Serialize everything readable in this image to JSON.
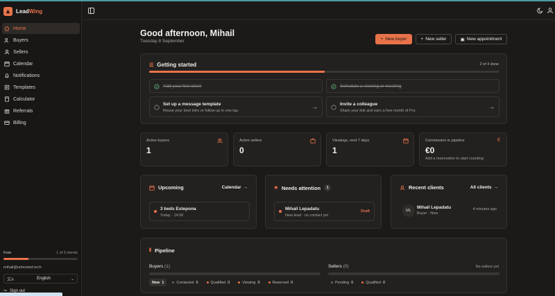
{
  "app": {
    "brand_part1": "Lead",
    "brand_part2": "Wing"
  },
  "colors": {
    "accent": "#e8734a",
    "background": "#1c1a19",
    "card": "#23211f"
  },
  "sidebar": {
    "items": [
      {
        "label": "Home",
        "icon": "home-icon",
        "active": true
      },
      {
        "label": "Buyers",
        "icon": "users-icon"
      },
      {
        "label": "Sellers",
        "icon": "user-icon"
      },
      {
        "label": "Calendar",
        "icon": "calendar-icon"
      },
      {
        "label": "Notifications",
        "icon": "bell-icon"
      },
      {
        "label": "Templates",
        "icon": "template-icon"
      },
      {
        "label": "Calculator",
        "icon": "calculator-icon"
      },
      {
        "label": "Referrals",
        "icon": "referral-icon"
      },
      {
        "label": "Billing",
        "icon": "card-icon"
      }
    ],
    "plan": {
      "name": "Free",
      "usage": "1 of 3 clients",
      "fraction": 0.333
    },
    "email": "mihail@unhosted.tech",
    "language": "English",
    "sign_out": "Sign out"
  },
  "main": {
    "greeting": "Good afternoon, Mihail",
    "date": "Tuesday 8 September",
    "actions": {
      "new_buyer": "New buyer",
      "new_seller": "New seller",
      "new_appointment": "New appointment"
    },
    "getting_started": {
      "title": "Getting started",
      "count": "2 of 4 done",
      "progress": 0.5,
      "tasks": [
        {
          "title": "Add your first client",
          "done": true
        },
        {
          "title": "Schedule a viewing or meeting",
          "done": true
        },
        {
          "title": "Set up a message template",
          "subtitle": "Reuse your best intro or follow-up in one tap."
        },
        {
          "title": "Invite a colleague",
          "subtitle": "Share your link and earn a free month of Pro."
        }
      ]
    },
    "stats": [
      {
        "label": "Active buyers",
        "value": "1",
        "icon": "users-icon"
      },
      {
        "label": "Active sellers",
        "value": "0",
        "icon": "briefcase-icon"
      },
      {
        "label": "Viewings, next 7 days",
        "value": "1",
        "icon": "calendar-icon"
      },
      {
        "label": "Commission in pipeline",
        "value": "€0",
        "icon": "euro-icon",
        "note": "Add a reservation to start counting"
      }
    ],
    "upcoming": {
      "title": "Upcoming",
      "link": "Calendar",
      "item": {
        "title": "3 beds Estepona",
        "subtitle": "Today · 14:00"
      }
    },
    "attention": {
      "title": "Needs attention",
      "badge": "1",
      "item": {
        "title": "Mihail Lepadatu",
        "subtitle": "New lead · no contact yet",
        "tag": "Draft"
      }
    },
    "recent": {
      "title": "Recent clients",
      "link": "All clients",
      "client": {
        "initials": "ML",
        "name": "Mihail Lepadatu",
        "subtitle": "Buyer · New",
        "time": "4 minutes ago"
      }
    },
    "pipeline": {
      "title": "Pipeline",
      "buyers_label": "Buyers",
      "buyers_count": "(1)",
      "sellers_label": "Sellers",
      "sellers_count": "(0)",
      "sellers_note": "No sellers yet",
      "buyer_stages": [
        {
          "label": "New",
          "count": "1",
          "active": true
        },
        {
          "label": "Contacted",
          "count": "0"
        },
        {
          "label": "Qualified",
          "count": "0"
        },
        {
          "label": "Viewing",
          "count": "0"
        },
        {
          "label": "Reserved",
          "count": "0"
        }
      ],
      "seller_stages": [
        {
          "label": "Pending",
          "count": "0"
        },
        {
          "label": "Qualified",
          "count": "0"
        }
      ]
    }
  }
}
